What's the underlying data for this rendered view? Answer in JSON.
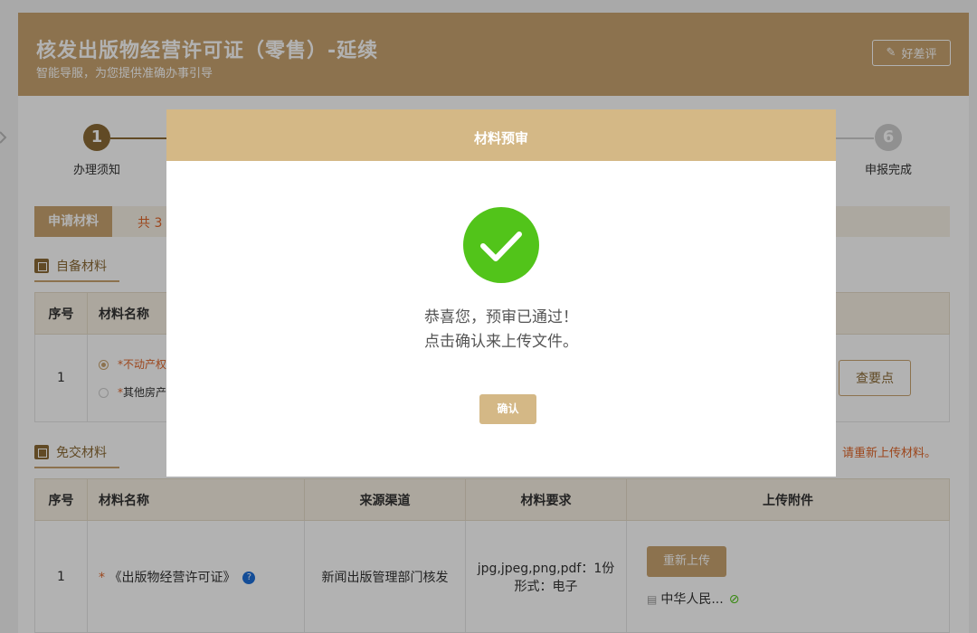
{
  "header": {
    "title": "核发出版物经营许可证（零售）-延续",
    "subtitle": "智能导服，为您提供准确办事引导",
    "rate_label": "好差评"
  },
  "steps": [
    {
      "num": "1",
      "label": "办理须知"
    },
    {
      "num": "6",
      "label": "申报完成"
    }
  ],
  "apply": {
    "tab_label": "申请材料",
    "count_text": "共 3"
  },
  "self_materials": {
    "title": "自备材料",
    "headers": [
      "序号",
      "材料名称"
    ],
    "rows": [
      {
        "index": "1",
        "opt1": "不动产权",
        "opt2": "其他房产",
        "view_label": "查要点"
      }
    ]
  },
  "exempt_materials": {
    "title": "免交材料",
    "reupload_note": "请重新上传材料。",
    "headers": [
      "序号",
      "材料名称",
      "来源渠道",
      "材料要求",
      "上传附件"
    ],
    "rows": [
      {
        "index": "1",
        "name": "《出版物经营许可证》",
        "source": "新闻出版管理部门核发",
        "req_line1": "jpg,jpeg,png,pdf：1份",
        "req_line2": "形式：电子",
        "reupload_label": "重新上传",
        "file_name": "中华人民..."
      }
    ]
  },
  "modal": {
    "title": "材料预审",
    "message1": "恭喜您，预审已通过！",
    "message2": "点击确认来上传文件。",
    "confirm_label": "确认"
  },
  "colors": {
    "accent": "#c9a470",
    "accent_dark": "#8b6a35",
    "modal_header": "#d4b886",
    "success": "#52c41a",
    "warning": "#e0662a"
  }
}
